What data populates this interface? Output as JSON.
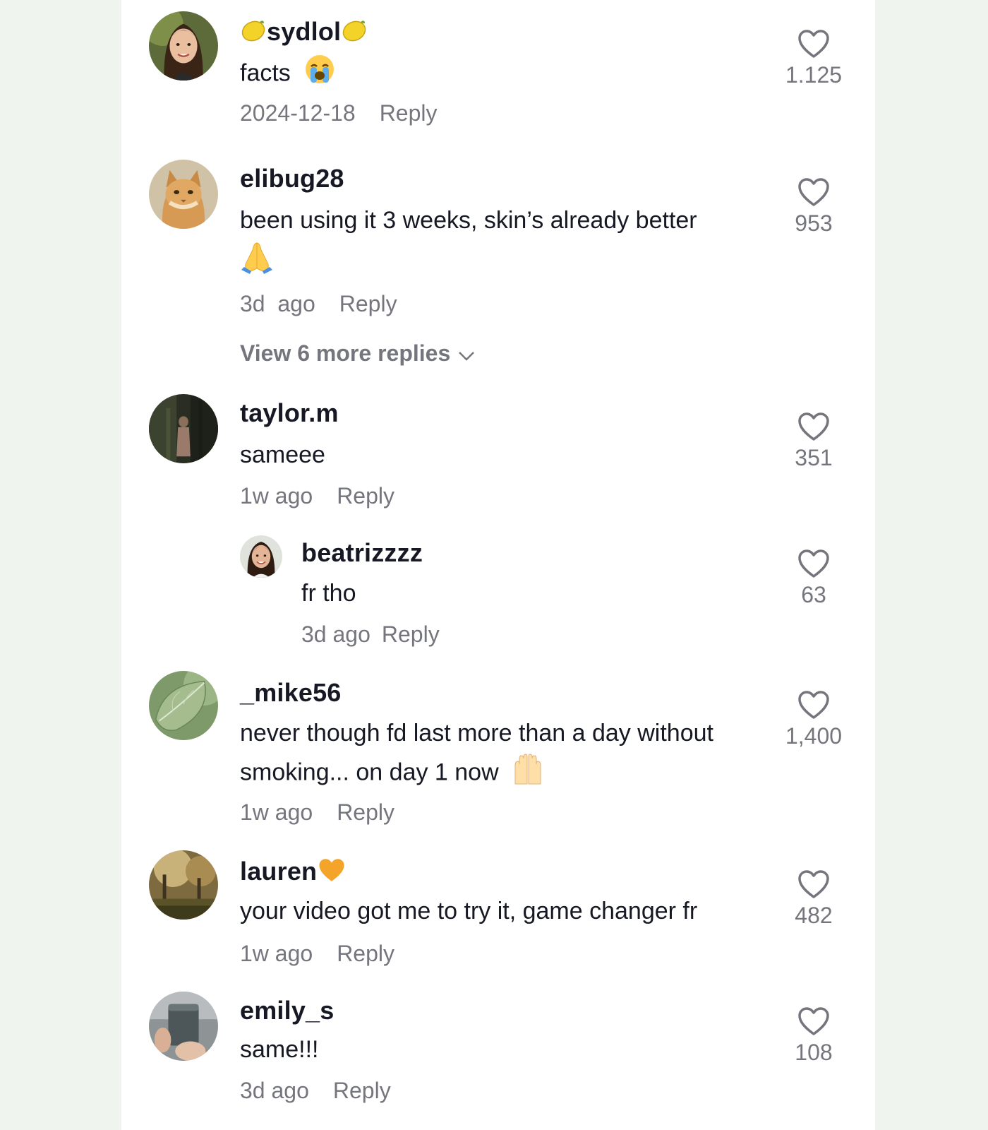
{
  "comments": [
    {
      "username": "sydlol",
      "text": "facts",
      "emoji": "😭",
      "timestamp": "2024-12-18",
      "reply_label": "Reply",
      "likes": "1.125",
      "avatar": "woman-portrait"
    },
    {
      "username": "elibug28",
      "text": "been using it 3 weeks, skin’s already better",
      "emoji": "🙏",
      "timestamp": "3d  ago",
      "reply_label": "Reply",
      "likes": "953",
      "avatar": "cat-photo",
      "more_replies": "View 6 more replies"
    },
    {
      "username": "taylor.m",
      "text": "sameee",
      "timestamp": "1w ago",
      "reply_label": "Reply",
      "likes": "351",
      "avatar": "forest-figure"
    },
    {
      "username": "beatrizzzz",
      "text": "fr tho",
      "timestamp": "3d ago",
      "reply_label": "Reply",
      "likes": "63",
      "avatar": "woman-portrait-2",
      "is_reply": true
    },
    {
      "username": "_mike56",
      "text_line1": "never though fd last more than a day without",
      "text_line2": "smoking... on day 1 now",
      "emoji": "🙌",
      "timestamp": "1w ago",
      "reply_label": "Reply",
      "likes": "1,400",
      "avatar": "green-leaf"
    },
    {
      "username": "lauren",
      "username_emoji": "🧡",
      "text": "your video got me to try it, game changer fr",
      "timestamp": "1w ago",
      "reply_label": "Reply",
      "likes": "482",
      "avatar": "autumn-trees"
    },
    {
      "username": "emily_s",
      "text": "same!!!",
      "timestamp": "3d ago",
      "reply_label": "Reply",
      "likes": "108",
      "avatar": "hand-holding-cup"
    }
  ],
  "colors": {
    "background": "#eff4ef",
    "panel": "#ffffff",
    "username": "#161823",
    "meta": "#75767d"
  }
}
